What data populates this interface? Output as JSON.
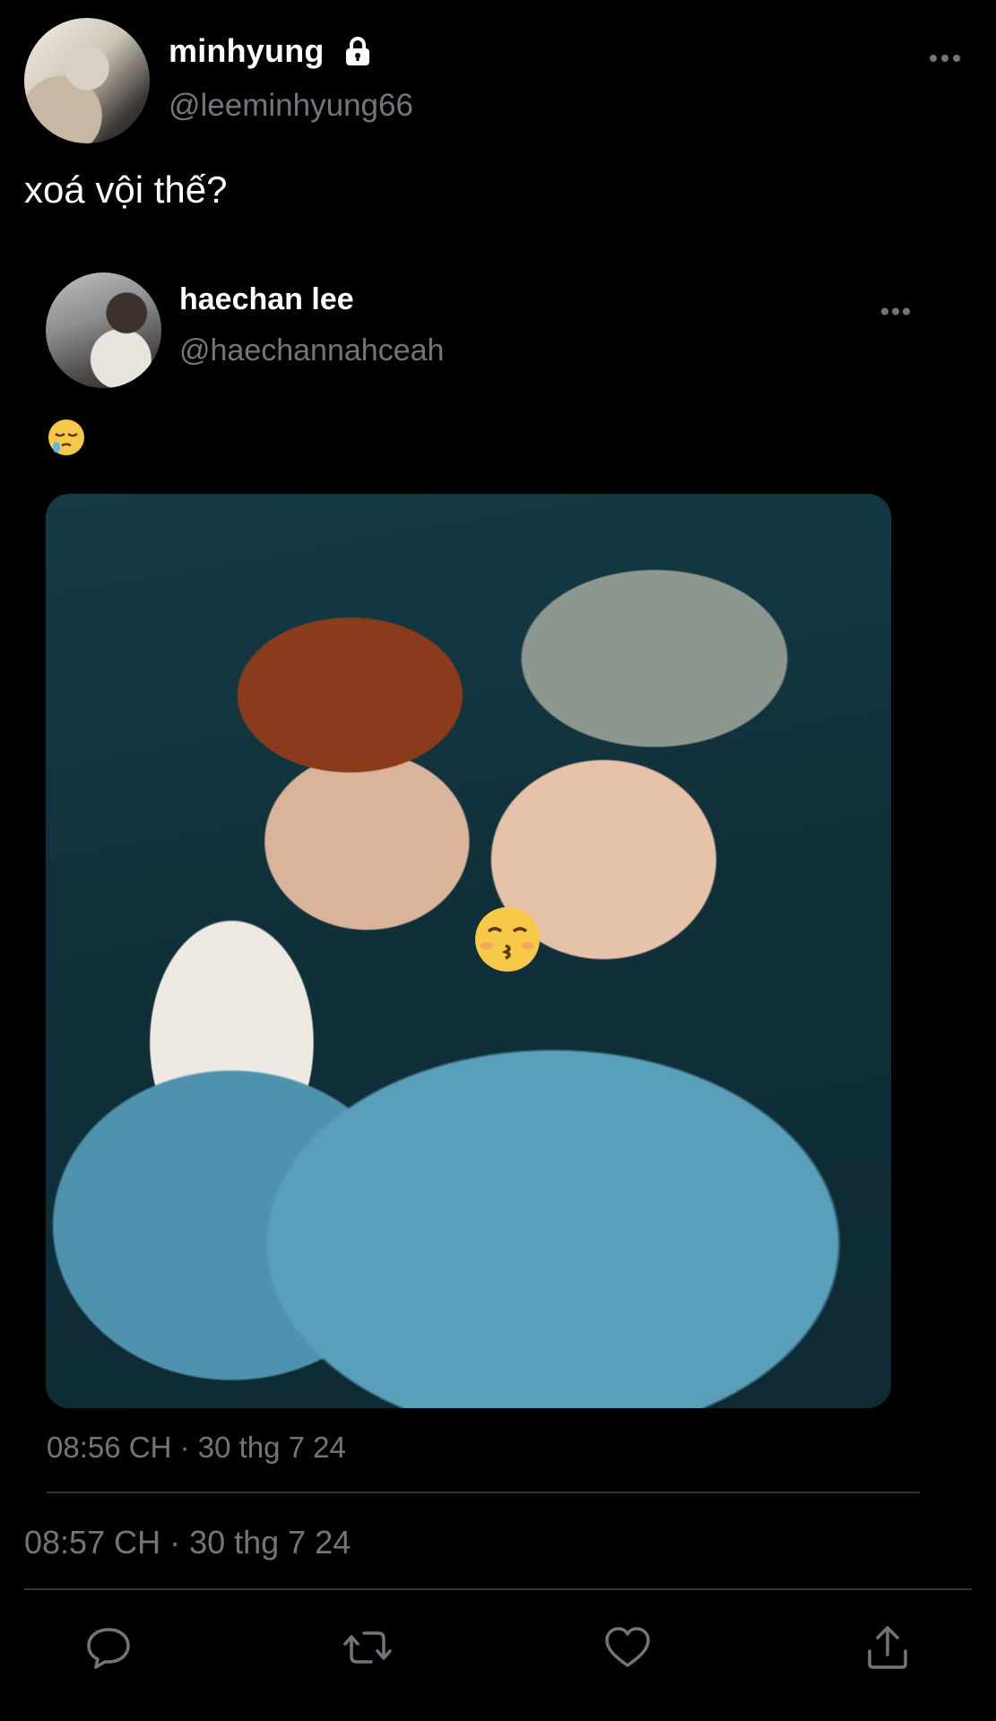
{
  "tweet": {
    "author": {
      "name": "minhyung",
      "handle": "@leeminhyung66",
      "avatar_icon": "avatar-photo",
      "protected_icon": "lock-icon"
    },
    "text": "xoá vội thế?",
    "timestamp": "08:57 CH · 30 thg 7 24",
    "more_icon": "more-horizontal-icon"
  },
  "quoted_tweet": {
    "author": {
      "name": "haechan lee",
      "handle": "@haechannahceah",
      "avatar_icon": "avatar-photo"
    },
    "emoji": "sleepy-face-emoji",
    "media": {
      "type": "photo",
      "overlay_emoji": "kissing-face-with-closed-eyes-emoji"
    },
    "timestamp": "08:56 CH · 30 thg 7 24",
    "more_icon": "more-horizontal-icon"
  },
  "actions": [
    {
      "name": "reply",
      "icon": "reply-icon"
    },
    {
      "name": "retweet",
      "icon": "retweet-icon"
    },
    {
      "name": "like",
      "icon": "heart-icon"
    },
    {
      "name": "share",
      "icon": "share-icon"
    }
  ],
  "colors": {
    "background": "#000000",
    "primary_text": "#ffffff",
    "secondary_text": "#71767b",
    "divider": "#2f3336"
  }
}
